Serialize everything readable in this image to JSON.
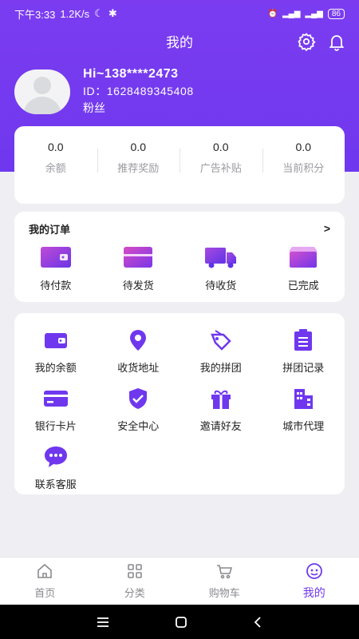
{
  "status_bar": {
    "time": "下午3:33",
    "speed": "1.2K/s",
    "battery": "86"
  },
  "header": {
    "title": "我的",
    "icons": [
      "gear-icon",
      "bell-icon"
    ]
  },
  "profile": {
    "name": "Hi~138****2473",
    "id": "ID：1628489345408",
    "fans": "粉丝"
  },
  "stats": [
    {
      "value": "0.0",
      "label": "余额"
    },
    {
      "value": "0.0",
      "label": "推荐奖励"
    },
    {
      "value": "0.0",
      "label": "广告补贴"
    },
    {
      "value": "0.0",
      "label": "当前积分"
    }
  ],
  "orders": {
    "title": "我的订单",
    "arrow": ">",
    "items": [
      {
        "label": "待付款",
        "icon": "wallet-icon"
      },
      {
        "label": "待发货",
        "icon": "box-icon"
      },
      {
        "label": "待收货",
        "icon": "truck-icon"
      },
      {
        "label": "已完成",
        "icon": "package-icon"
      }
    ]
  },
  "services": {
    "items": [
      {
        "label": "我的余额",
        "icon": "wallet-icon"
      },
      {
        "label": "收货地址",
        "icon": "location-pin-icon"
      },
      {
        "label": "我的拼团",
        "icon": "tag-icon"
      },
      {
        "label": "拼团记录",
        "icon": "clipboard-icon"
      },
      {
        "label": "银行卡片",
        "icon": "bank-card-icon"
      },
      {
        "label": "安全中心",
        "icon": "shield-icon"
      },
      {
        "label": "邀请好友",
        "icon": "gift-icon"
      },
      {
        "label": "城市代理",
        "icon": "building-icon"
      },
      {
        "label": "联系客服",
        "icon": "chat-bubble-icon"
      }
    ]
  },
  "tabbar": [
    {
      "label": "首页",
      "icon": "home-icon"
    },
    {
      "label": "分类",
      "icon": "grid-icon"
    },
    {
      "label": "购物车",
      "icon": "cart-icon"
    },
    {
      "label": "我的",
      "icon": "profile-icon",
      "active": true
    }
  ],
  "colors": {
    "accent": "#6f38ee",
    "background": "#efeff3"
  }
}
